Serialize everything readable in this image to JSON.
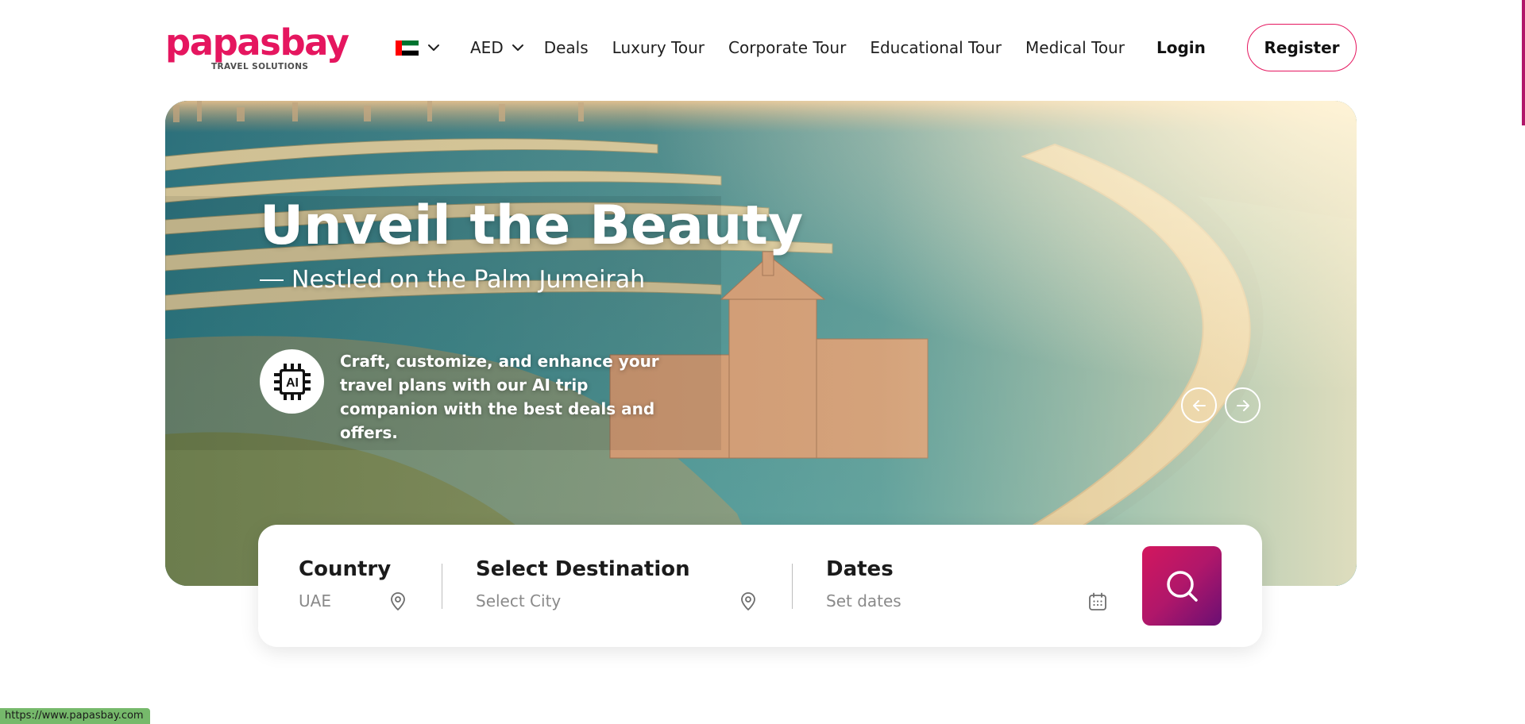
{
  "brand": {
    "name": "papasbay",
    "tagline": "TRAVEL SOLUTIONS",
    "color": "#e5165f"
  },
  "header": {
    "flag_icon": "uae-flag-icon",
    "currency": "AED",
    "nav_links": [
      "Deals",
      "Luxury Tour",
      "Corporate Tour",
      "Educational Tour",
      "Medical Tour"
    ],
    "login_label": "Login",
    "register_label": "Register"
  },
  "hero": {
    "title": "Unveil the Beauty",
    "subtitle": "Nestled on the Palm Jumeirah",
    "ai_icon_label": "AI",
    "ai_description": "Craft, customize, and enhance your travel plans with our AI trip companion with the best deals and offers.",
    "prev_icon": "arrow-left-icon",
    "next_icon": "arrow-right-icon"
  },
  "search": {
    "country_label": "Country",
    "country_value": "UAE",
    "destination_label": "Select Destination",
    "destination_placeholder": "Select City",
    "dates_label": "Dates",
    "dates_placeholder": "Set dates",
    "button_icon": "search-icon",
    "button_gradient": [
      "#d3175e",
      "#6a0f73"
    ]
  },
  "status_bar": {
    "url": "https://www.papasbay.com"
  }
}
